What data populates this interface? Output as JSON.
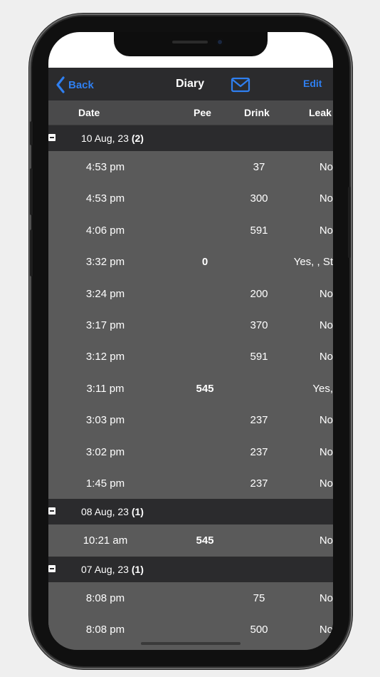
{
  "navbar": {
    "back_label": "Back",
    "title": "Diary",
    "edit_label": "Edit",
    "accent_color": "#2f7ff0"
  },
  "columns": [
    "Date",
    "Pee",
    "Drink",
    "Leak"
  ],
  "groups": [
    {
      "date": "10 Aug, 23",
      "count": "(2)",
      "entries": [
        {
          "time": "4:53 pm",
          "pee": "",
          "drink": "37",
          "leak": "No"
        },
        {
          "time": "4:53 pm",
          "pee": "",
          "drink": "300",
          "leak": "No"
        },
        {
          "time": "4:06 pm",
          "pee": "",
          "drink": "591",
          "leak": "No"
        },
        {
          "time": "3:32 pm",
          "pee": "0",
          "drink": "",
          "leak": "Yes, , St"
        },
        {
          "time": "3:24 pm",
          "pee": "",
          "drink": "200",
          "leak": "No"
        },
        {
          "time": "3:17 pm",
          "pee": "",
          "drink": "370",
          "leak": "No"
        },
        {
          "time": "3:12 pm",
          "pee": "",
          "drink": "591",
          "leak": "No"
        },
        {
          "time": "3:11 pm",
          "pee": "545",
          "drink": "",
          "leak": "Yes,"
        },
        {
          "time": "3:03 pm",
          "pee": "",
          "drink": "237",
          "leak": "No"
        },
        {
          "time": "3:02 pm",
          "pee": "",
          "drink": "237",
          "leak": "No"
        },
        {
          "time": "1:45 pm",
          "pee": "",
          "drink": "237",
          "leak": "No"
        }
      ]
    },
    {
      "date": "08 Aug, 23",
      "count": "(1)",
      "entries": [
        {
          "time": "10:21 am",
          "pee": "545",
          "drink": "",
          "leak": "No"
        }
      ]
    },
    {
      "date": "07 Aug, 23",
      "count": "(1)",
      "entries": [
        {
          "time": "8:08 pm",
          "pee": "",
          "drink": "75",
          "leak": "No"
        },
        {
          "time": "8:08 pm",
          "pee": "",
          "drink": "500",
          "leak": "No"
        }
      ]
    }
  ],
  "icons": {
    "back": "chevron-left-icon",
    "mail": "mail-envelope-icon",
    "collapse": "collapse-minus-icon"
  }
}
